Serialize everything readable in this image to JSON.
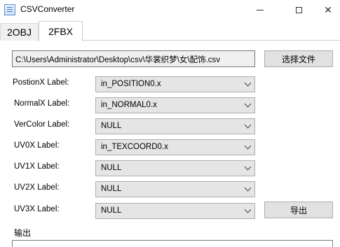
{
  "window": {
    "title": "CSVConverter",
    "icon": "app-icon",
    "controls": [
      "minimize-icon",
      "maximize-icon",
      "close-icon"
    ]
  },
  "tabs": [
    {
      "label": "2OBJ",
      "selected": false
    },
    {
      "label": "2FBX",
      "selected": true
    }
  ],
  "file": {
    "path": "C:\\Users\\Administrator\\Desktop\\csv\\华裳织梦\\女\\配饰.csv",
    "choose_label": "选择文件"
  },
  "fields": [
    {
      "label": "PostionX Label:",
      "value": "in_POSITION0.x"
    },
    {
      "label": "NormalX Label:",
      "value": "in_NORMAL0.x"
    },
    {
      "label": "VerColor Label:",
      "value": "NULL"
    },
    {
      "label": "UV0X Label:",
      "value": "in_TEXCOORD0.x"
    },
    {
      "label": "UV1X Label:",
      "value": "NULL"
    },
    {
      "label": "UV2X Label:",
      "value": "NULL"
    },
    {
      "label": "UV3X Label:",
      "value": "NULL"
    }
  ],
  "export_label": "导出",
  "output": {
    "label": "输出",
    "text": ""
  }
}
